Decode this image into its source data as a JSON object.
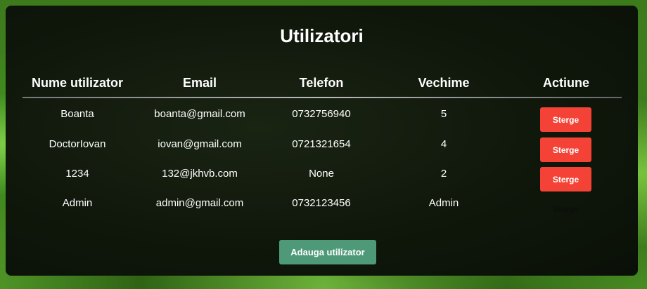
{
  "title": "Utilizatori",
  "headers": [
    "Nume utilizator",
    "Email",
    "Telefon",
    "Vechime",
    "Actiune"
  ],
  "rows": [
    {
      "name": "Boanta",
      "email": "boanta@gmail.com",
      "phone": "0732756940",
      "vechime": "5",
      "action": "Sterge"
    },
    {
      "name": "DoctorIovan",
      "email": "iovan@gmail.com",
      "phone": "0721321654",
      "vechime": "4",
      "action": "Sterge"
    },
    {
      "name": "1234",
      "email": "132@jkhvb.com",
      "phone": "None",
      "vechime": "2",
      "action": "Sterge"
    },
    {
      "name": "Admin",
      "email": "admin@gmail.com",
      "phone": "0732123456",
      "vechime": "Admin",
      "action": "Sterge"
    }
  ],
  "add_button": "Adauga utilizator",
  "colors": {
    "delete": "#f44336",
    "add": "#4e9a78"
  }
}
